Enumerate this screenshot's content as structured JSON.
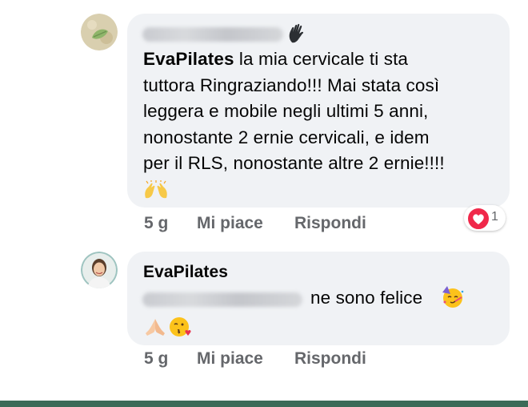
{
  "comments": [
    {
      "author_redacted": true,
      "author_icon": "waving-hand-icon",
      "mention": "EvaPilates",
      "text_lines": [
        " la mia cervicale ti sta",
        "tuttora Ringraziando!!! Mai stata così",
        "leggera e mobile negli ultimi 5 anni,",
        "nonostante 2 ernie cervicali, e idem",
        "per il RLS, nonostante altre 2 ernie!!!!"
      ],
      "trailing_emoji": "raising-hands-icon",
      "time": "5 g",
      "like_label": "Mi piace",
      "reply_label": "Rispondi",
      "reaction_icon": "heart-reaction-icon",
      "reaction_count": "1"
    },
    {
      "author": "EvaPilates",
      "mention_redacted": true,
      "text": "ne sono felice",
      "emojis": [
        "partying-face-icon",
        "praying-hands-icon",
        "kissing-face-icon"
      ],
      "time": "5 g",
      "like_label": "Mi piace",
      "reply_label": "Rispondi"
    }
  ],
  "colors": {
    "bubble": "#f0f2f5",
    "meta_text": "#65676b",
    "heart": "#f0284a",
    "bottom_bar": "#3b6b58"
  }
}
